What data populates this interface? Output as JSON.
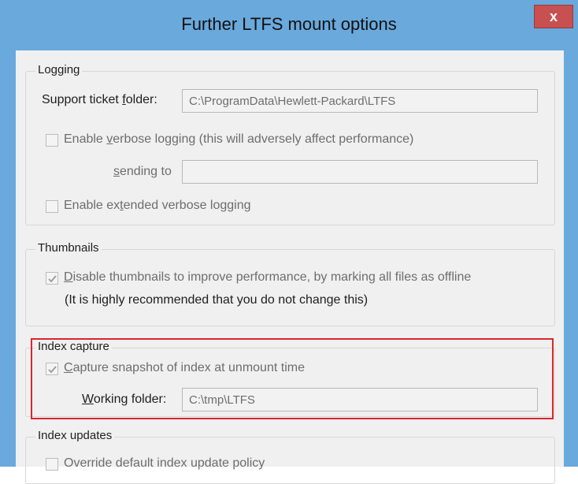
{
  "window": {
    "title": "Further LTFS mount options",
    "close_label": "x"
  },
  "logging": {
    "legend": "Logging",
    "support_ticket_label_pre": "Support ticket ",
    "support_ticket_label_u": "f",
    "support_ticket_label_post": "older:",
    "support_ticket_value": "C:\\ProgramData\\Hewlett-Packard\\LTFS",
    "verbose_pre": "Enable ",
    "verbose_u": "v",
    "verbose_post": "erbose logging (this will adversely affect performance)",
    "sending_u": "s",
    "sending_post": "ending to",
    "sending_value": "",
    "extended_pre": "Enable ex",
    "extended_u": "t",
    "extended_post": "ended verbose logging"
  },
  "thumbnails": {
    "legend": "Thumbnails",
    "disable_u": "D",
    "disable_post": "isable thumbnails to improve performance, by marking all files as offline",
    "note": "(It is highly recommended that you do not change this)"
  },
  "index_capture": {
    "legend": "Index capture",
    "capture_u": "C",
    "capture_post": "apture snapshot of index at unmount time",
    "working_u": "W",
    "working_post": "orking folder:",
    "working_value": "C:\\tmp\\LTFS"
  },
  "index_updates": {
    "legend": "Index updates",
    "override_label": "Override default index update policy"
  }
}
